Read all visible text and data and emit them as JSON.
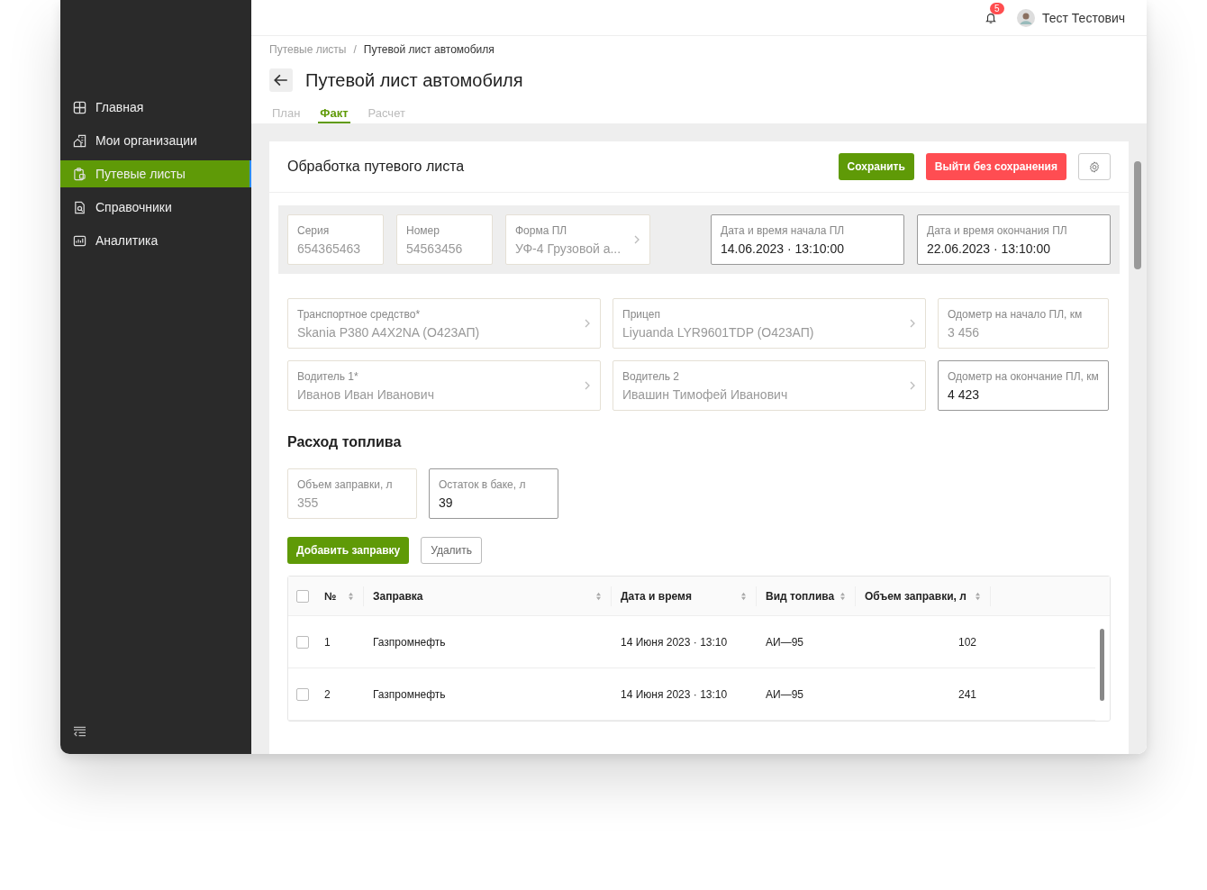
{
  "sidebar": {
    "items": [
      {
        "label": "Главная",
        "selected": false
      },
      {
        "label": "Мои организации",
        "selected": false
      },
      {
        "label": "Путевые листы",
        "selected": true
      },
      {
        "label": "Справочники",
        "selected": false
      },
      {
        "label": "Аналитика",
        "selected": false
      }
    ]
  },
  "header": {
    "notifications": "5",
    "user": "Тест Тестович"
  },
  "breadcrumbs": [
    "Путевые листы",
    "Путевой лист автомобиля"
  ],
  "breadcrumb_separator": "/",
  "title": "Путевой лист автомобиля",
  "tabs": [
    {
      "label": "План",
      "selected": false
    },
    {
      "label": "Факт",
      "selected": true
    },
    {
      "label": "Расчет",
      "selected": false
    }
  ],
  "card": {
    "title": "Обработка путевого листа",
    "buttons": {
      "save": "Сохранить",
      "exit": "Выйти без сохранения"
    }
  },
  "summary_fields": [
    {
      "label": "Серия",
      "value": "654365463",
      "kind": "input",
      "editable": false
    },
    {
      "label": "Номер",
      "value": "54563456",
      "kind": "input",
      "editable": false
    },
    {
      "label": "Форма ПЛ",
      "value": "УФ-4 Грузовой а...",
      "kind": "select",
      "editable": false
    },
    {
      "label": "Дата и время начала ПЛ",
      "value": "14.06.2023 · 13:10:00",
      "kind": "input",
      "editable": true
    },
    {
      "label": "Дата и время окончания ПЛ",
      "value": "22.06.2023 · 13:10:00",
      "kind": "input",
      "editable": true
    }
  ],
  "vehicle_fields": [
    {
      "label": "Транспортное средство*",
      "value": "Skania P380 A4X2NA (О423АП)",
      "kind": "select",
      "editable": false
    },
    {
      "label": "Прицеп",
      "value": "Liyuanda LYR9601TDP (О423АП)",
      "kind": "select",
      "editable": false
    },
    {
      "label": "Одометр на начало ПЛ, км",
      "value": "3 456",
      "kind": "input",
      "editable": false
    },
    {
      "label": "Водитель 1*",
      "value": "Иванов Иван Иванович",
      "kind": "select",
      "editable": false
    },
    {
      "label": "Водитель 2",
      "value": "Ивашин Тимофей Иванович",
      "kind": "select",
      "editable": false
    },
    {
      "label": "Одометр на окончание ПЛ, км",
      "value": "4 423",
      "kind": "input",
      "editable": true
    }
  ],
  "fuel": {
    "title": "Расход топлива",
    "fields": [
      {
        "label": "Объем заправки, л",
        "value": "355",
        "editable": false
      },
      {
        "label": "Остаток в баке, л",
        "value": "39",
        "editable": true
      }
    ],
    "buttons": {
      "add": "Добавить заправку",
      "delete": "Удалить"
    }
  },
  "table": {
    "header_checked": false,
    "columns": [
      "№",
      "Заправка",
      "Дата и время",
      "Вид топлива",
      "Объем заправки, л"
    ],
    "rows": [
      {
        "checked": false,
        "cells": [
          "1",
          "Газпромнефть",
          "14 Июня 2023 · 13:10",
          "АИ—95",
          "102"
        ]
      },
      {
        "checked": false,
        "cells": [
          "2",
          "Газпромнефть",
          "14 Июня 2023 · 13:10",
          "АИ—95",
          "241"
        ]
      }
    ]
  }
}
